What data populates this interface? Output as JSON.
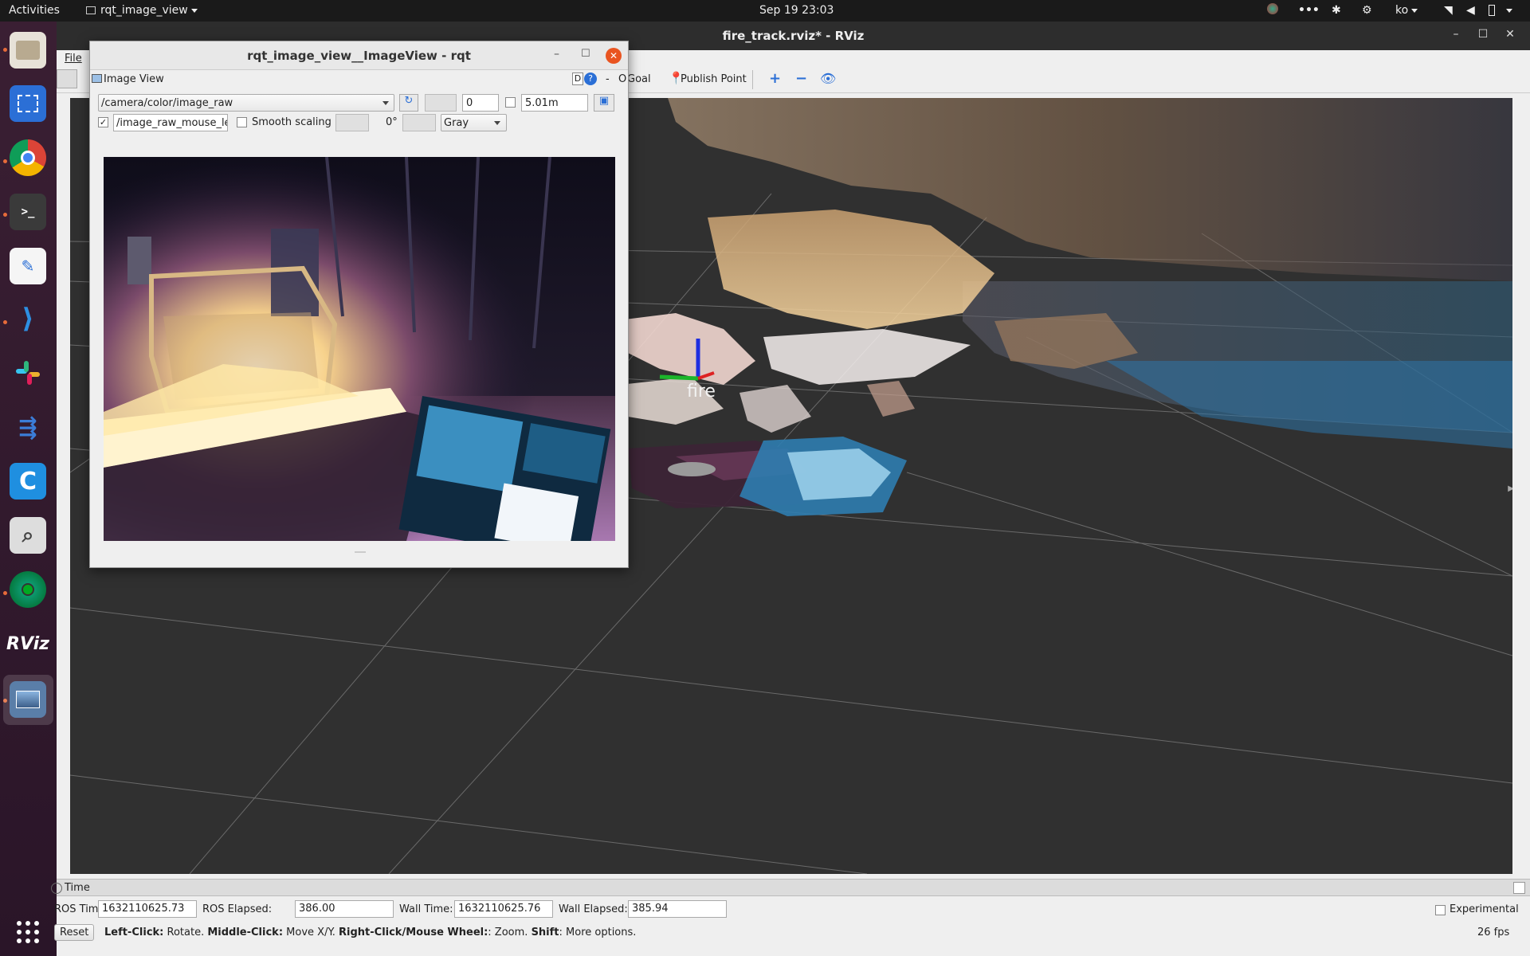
{
  "topbar": {
    "activities": "Activities",
    "app_menu": "rqt_image_view",
    "datetime": "Sep 19  23:03",
    "input_lang": "ko"
  },
  "dock": {
    "items": [
      "files-icon",
      "screenshot-icon",
      "chrome-icon",
      "terminal-icon",
      "text-editor-icon",
      "vscode-icon",
      "slack-icon",
      "rqt-icon",
      "clion-icon",
      "magnifier-icon",
      "camera-icon",
      "rviz-icon",
      "image-viewer-icon"
    ],
    "rviz_text": "RViz"
  },
  "rviz": {
    "title": "fire_track.rviz* - RViz",
    "menu_file": "File",
    "toolbar": {
      "goal_label": "Goal",
      "publish_point_label": "Publish Point"
    },
    "marker_label": "fire",
    "time_panel": {
      "header": "Time",
      "ros_time_label": "ROS Time:",
      "ros_time_value": "1632110625.73",
      "ros_elapsed_label": "ROS Elapsed:",
      "ros_elapsed_value": "386.00",
      "wall_time_label": "Wall Time:",
      "wall_time_value": "1632110625.76",
      "wall_elapsed_label": "Wall Elapsed:",
      "wall_elapsed_value": "385.94",
      "experimental_label": "Experimental"
    },
    "status": {
      "reset_label": "Reset",
      "left_click": "Left-Click:",
      "left_click_desc": " Rotate. ",
      "middle_click": "Middle-Click:",
      "middle_click_desc": " Move X/Y. ",
      "right_click": "Right-Click/Mouse Wheel:",
      "right_click_desc": ": Zoom. ",
      "shift": "Shift",
      "shift_desc": ": More options.",
      "fps": "26 fps"
    }
  },
  "rqt": {
    "title": "rqt_image_view__ImageView - rqt",
    "plugin_label": "Image View",
    "topic": "/camera/color/image_raw",
    "min_value": "0",
    "max_value": "5.01m",
    "mouse_topic": "/image_raw_mouse_left",
    "smooth_scaling_label": "Smooth scaling",
    "rotation": "0°",
    "color_scheme": "Gray",
    "d_label": "D",
    "help_label": "?",
    "close_label": "O"
  }
}
